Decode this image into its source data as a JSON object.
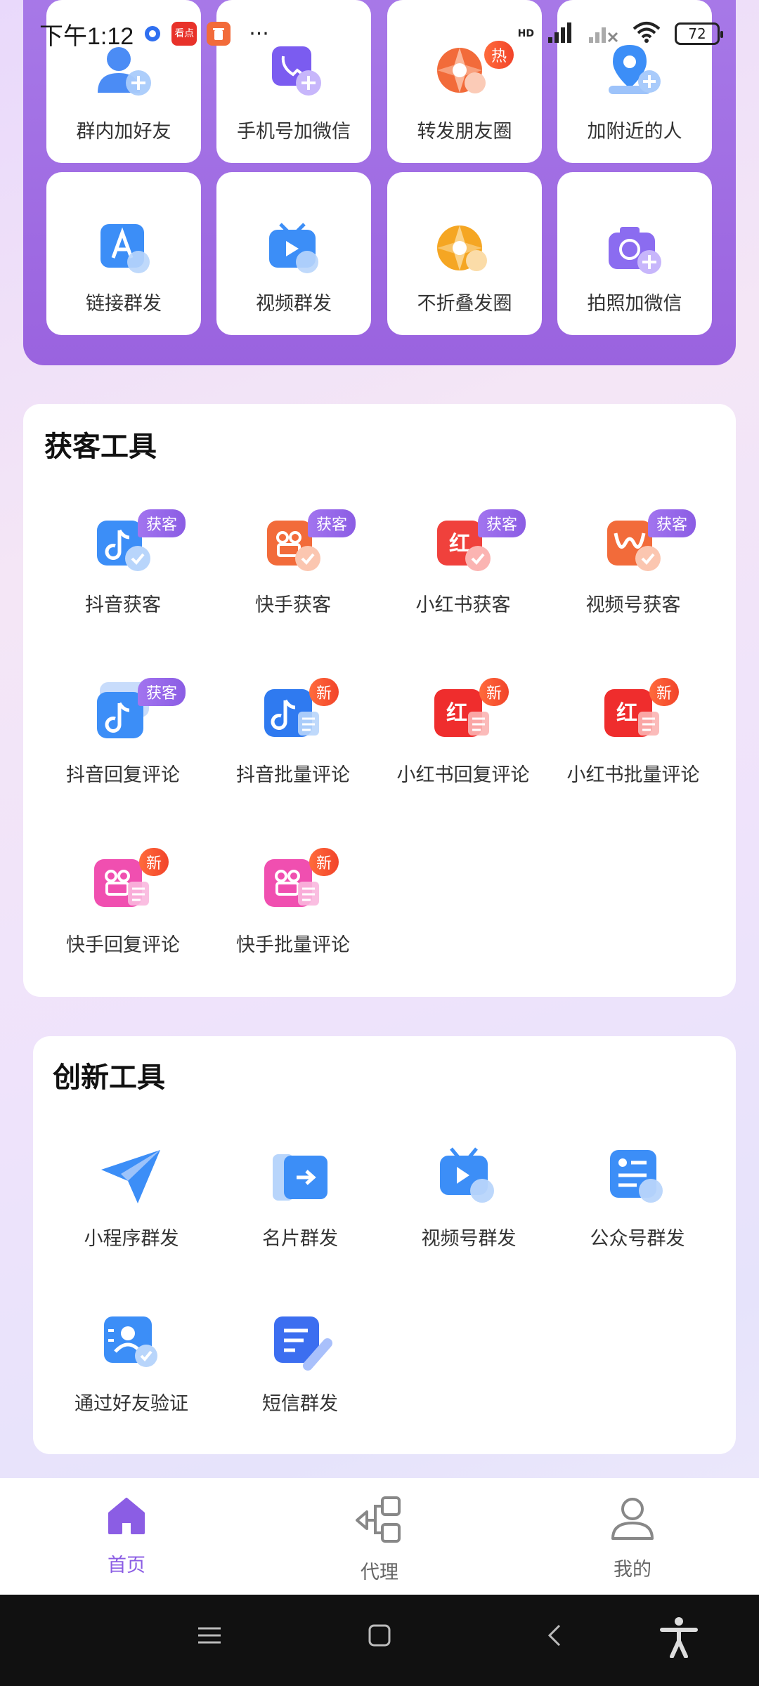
{
  "status_bar": {
    "time": "下午1:12",
    "app_badge": "看点",
    "more": "···",
    "network": "HD",
    "battery": "72"
  },
  "quick_tiles": [
    {
      "label": "群内加好友",
      "icon": "user-add-icon",
      "color": "#4b8cf5"
    },
    {
      "label": "手机号加微信",
      "icon": "phone-add-icon",
      "color": "#7b5cf0"
    },
    {
      "label": "转发朋友圈",
      "icon": "moments-icon",
      "color": "#f26b3a",
      "badge": "热"
    },
    {
      "label": "加附近的人",
      "icon": "location-add-icon",
      "color": "#3c8ef7"
    },
    {
      "label": "链接群发",
      "icon": "link-send-icon",
      "color": "#4b8cf5"
    },
    {
      "label": "视频群发",
      "icon": "video-send-icon",
      "color": "#3c8ef7"
    },
    {
      "label": "不折叠发圈",
      "icon": "moments-unfold-icon",
      "color": "#f5a623"
    },
    {
      "label": "拍照加微信",
      "icon": "camera-add-icon",
      "color": "#8b6cf0"
    }
  ],
  "section_customer": {
    "title": "获客工具",
    "items": [
      {
        "label": "抖音获客",
        "icon": "douyin-icon",
        "badge": "获客",
        "badge_type": "ke",
        "color": "#3c8ef7"
      },
      {
        "label": "快手获客",
        "icon": "kuaishou-icon",
        "badge": "获客",
        "badge_type": "ke",
        "color": "#f26b3a"
      },
      {
        "label": "小红书获客",
        "icon": "xiaohongshu-icon",
        "badge": "获客",
        "badge_type": "ke",
        "color": "#f0413c"
      },
      {
        "label": "视频号获客",
        "icon": "channels-icon",
        "badge": "获客",
        "badge_type": "ke",
        "color": "#f26b3a"
      },
      {
        "label": "抖音回复评论",
        "icon": "douyin-reply-icon",
        "badge": "获客",
        "badge_type": "ke",
        "color": "#3c8ef7"
      },
      {
        "label": "抖音批量评论",
        "icon": "douyin-batch-icon",
        "badge": "新",
        "badge_type": "new",
        "color": "#2f7af0"
      },
      {
        "label": "小红书回复评论",
        "icon": "xhs-reply-icon",
        "badge": "新",
        "badge_type": "new",
        "color": "#ef2d2d"
      },
      {
        "label": "小红书批量评论",
        "icon": "xhs-batch-icon",
        "badge": "新",
        "badge_type": "new",
        "color": "#ef2d2d"
      },
      {
        "label": "快手回复评论",
        "icon": "kuaishou-reply-icon",
        "badge": "新",
        "badge_type": "new",
        "color": "#f04fb0"
      },
      {
        "label": "快手批量评论",
        "icon": "kuaishou-batch-icon",
        "badge": "新",
        "badge_type": "new",
        "color": "#f04fb0"
      }
    ]
  },
  "section_innovation": {
    "title": "创新工具",
    "items": [
      {
        "label": "小程序群发",
        "icon": "miniprogram-send-icon",
        "color": "#3c8ef7"
      },
      {
        "label": "名片群发",
        "icon": "card-send-icon",
        "color": "#3c8ef7"
      },
      {
        "label": "视频号群发",
        "icon": "channels-send-icon",
        "color": "#3c8ef7"
      },
      {
        "label": "公众号群发",
        "icon": "official-account-icon",
        "color": "#3c8ef7"
      },
      {
        "label": "通过好友验证",
        "icon": "friend-verify-icon",
        "color": "#3c8ef7"
      },
      {
        "label": "短信群发",
        "icon": "sms-send-icon",
        "color": "#3c6ef0"
      }
    ]
  },
  "bottom_nav": [
    {
      "label": "首页",
      "icon": "home-icon",
      "active": true
    },
    {
      "label": "代理",
      "icon": "agent-network-icon",
      "active": false
    },
    {
      "label": "我的",
      "icon": "profile-icon",
      "active": false
    }
  ],
  "colors": {
    "accent": "#8b5de4",
    "panel": "#9a63df",
    "badge_new": "#f2442a",
    "badge_ke": "#9a6ae8"
  }
}
